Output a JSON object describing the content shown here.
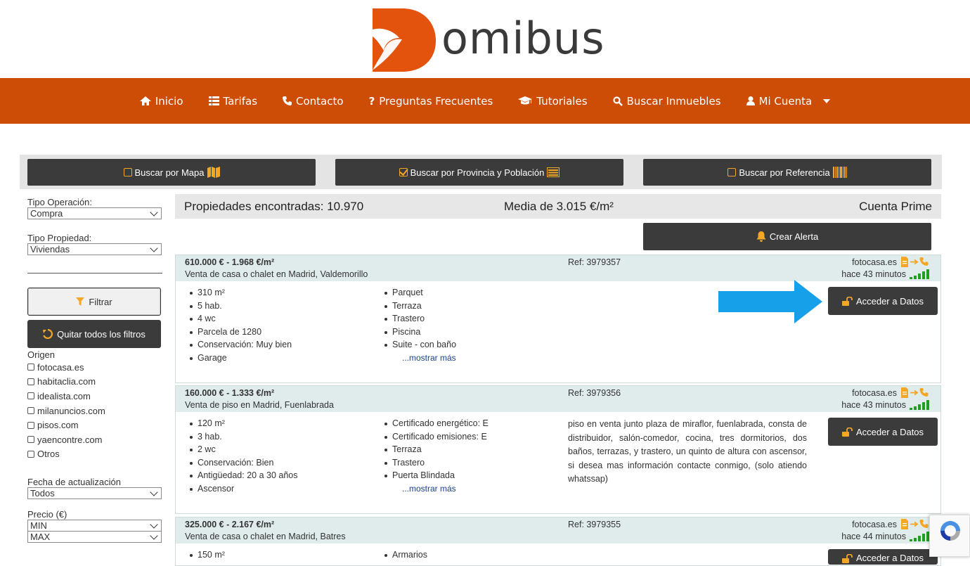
{
  "brand": {
    "name": "omibus",
    "logo_color": "#e3530d",
    "nav_color": "#cd4c06"
  },
  "nav": {
    "items": [
      {
        "label": "Inicio",
        "icon": "home-icon"
      },
      {
        "label": "Tarifas",
        "icon": "list-icon"
      },
      {
        "label": "Contacto",
        "icon": "phone-icon"
      },
      {
        "label": "Preguntas Frecuentes",
        "icon": "question-icon"
      },
      {
        "label": "Tutoriales",
        "icon": "graduation-cap-icon"
      },
      {
        "label": "Buscar Inmuebles",
        "icon": "search-icon"
      },
      {
        "label": "Mi Cuenta",
        "icon": "user-icon"
      }
    ]
  },
  "search_modes": {
    "map": {
      "label": "Buscar por Mapa",
      "checked": false
    },
    "province": {
      "label": "Buscar por Provincia y Población",
      "checked": true
    },
    "reference": {
      "label": "Buscar por Referencia",
      "checked": false
    }
  },
  "sidebar": {
    "tipo_operacion_label": "Tipo Operación:",
    "tipo_operacion_value": "Compra",
    "tipo_propiedad_label": "Tipo Propiedad:",
    "tipo_propiedad_value": "Viviendas",
    "filter_label": "Filtrar",
    "clear_label": "Quitar todos los filtros",
    "origin_label": "Origen",
    "origins": [
      "fotocasa.es",
      "habitaclia.com",
      "idealista.com",
      "milanuncios.com",
      "pisos.com",
      "yaencontre.com",
      "Otros"
    ],
    "fecha_label": "Fecha de actualización",
    "fecha_value": "Todos",
    "precio_label": "Precio (€)",
    "precio_min": "MIN",
    "precio_max": "MAX"
  },
  "results": {
    "found": "Propiedades encontradas: 10.970",
    "average": "Media de 3.015 €/m²",
    "account": "Cuenta Prime",
    "alert_label": "Crear Alerta"
  },
  "listings": [
    {
      "price": "610.000 € - 1.968 €/m²",
      "location": "Venta de casa o chalet en Madrid, Valdemorillo",
      "ref": "Ref: 3979357",
      "source": "fotocasa.es",
      "ago": "hace 43 minutos",
      "col1": [
        "310 m²",
        "5 hab.",
        "4 wc",
        "Parcela de 1280",
        "Conservación: Muy bien",
        "Garage"
      ],
      "col2": [
        "Parquet",
        "Terraza",
        "Trastero",
        "Piscina",
        "Suite - con baño"
      ],
      "more": "...mostrar más",
      "description": "",
      "access_label": "Acceder a Datos"
    },
    {
      "price": "160.000 € - 1.333 €/m²",
      "location": "Venta de piso en Madrid, Fuenlabrada",
      "ref": "Ref: 3979356",
      "source": "fotocasa.es",
      "ago": "hace 43 minutos",
      "col1": [
        "120 m²",
        "3 hab.",
        "2 wc",
        "Conservación: Bien",
        "Antigüedad: 20 a 30 años",
        "Ascensor"
      ],
      "col2": [
        "Certificado energético: E",
        "Certificado emisiones: E",
        "Terraza",
        "Trastero",
        "Puerta Blindada"
      ],
      "more": "...mostrar más",
      "description": "piso en venta junto plaza de miraflor, fuenlabrada, consta de distribuidor, salón-comedor, cocina, tres dormitorios, dos baños, terrazas, y trastero, un quinto de altura con ascensor, si desea mas información contacte conmigo, (solo atiendo whatssap)",
      "access_label": "Acceder a Datos"
    },
    {
      "price": "325.000 € - 2.167 €/m²",
      "location": "Venta de casa o chalet en Madrid, Batres",
      "ref": "Ref: 3979355",
      "source": "fotocasa.es",
      "ago": "hace 44 minutos",
      "col1": [
        "150 m²"
      ],
      "col2": [
        "Armarios"
      ],
      "more": "",
      "description": "",
      "access_label": "Acceder a Datos"
    }
  ]
}
